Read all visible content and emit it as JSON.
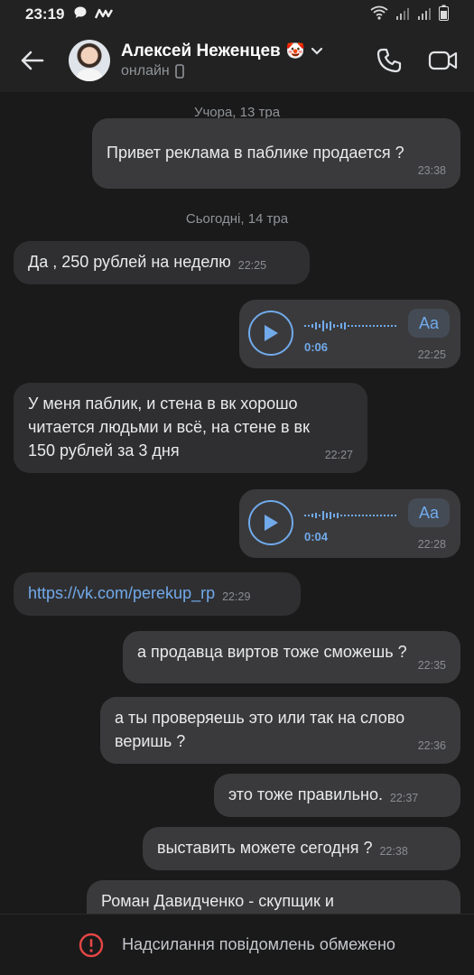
{
  "status_bar": {
    "time": "23:19"
  },
  "header": {
    "name": "Алексей Неженцев",
    "name_emoji": "🤡",
    "status": "онлайн"
  },
  "chat": {
    "date_yesterday": "Учора, 13 тра",
    "date_today": "Сьогодні, 14 тра",
    "messages": [
      {
        "text": "Привет реклама в паблике продается ?",
        "time": "23:38",
        "dir": "out"
      },
      {
        "text": "Да , 250 рублей на неделю",
        "time": "22:25",
        "dir": "in"
      },
      {
        "type": "voice",
        "duration": "0:06",
        "time": "22:25",
        "dir": "out",
        "transcribe_label": "Aa"
      },
      {
        "text": "У меня паблик, и стена в вк хорошо читается  людьми и всё, на стене в вк 150 рублей за 3 дня",
        "line1": "У меня паблик, и стена в вк хорошо",
        "line2": "читается  людьми и всё, на стене в вк",
        "line3": "150 рублей за 3 дня",
        "time": "22:27",
        "dir": "in"
      },
      {
        "type": "voice",
        "duration": "0:04",
        "time": "22:28",
        "dir": "out",
        "transcribe_label": "Aa"
      },
      {
        "text": "https://vk.com/perekup_rp",
        "time": "22:29",
        "dir": "in"
      },
      {
        "text": "а продавца виртов тоже сможешь ?",
        "time": "22:35",
        "dir": "out"
      },
      {
        "line1": "а ты проверяешь это или так на слово",
        "line2": "веришь ?",
        "time": "22:36",
        "dir": "out"
      },
      {
        "text": "это тоже правильно.",
        "time": "22:37",
        "dir": "out"
      },
      {
        "text": "выставить можете сегодня ?",
        "time": "22:38",
        "dir": "out"
      },
      {
        "text": "Роман Давидченко - скупщик и",
        "dir": "out"
      }
    ]
  },
  "footer": {
    "restricted_text": "Надсилання повідомлень обмежено"
  },
  "colors": {
    "accent": "#71aaeb",
    "bubble": "#3a3a3c",
    "background": "#1a1a1a",
    "warning": "#e64646"
  }
}
